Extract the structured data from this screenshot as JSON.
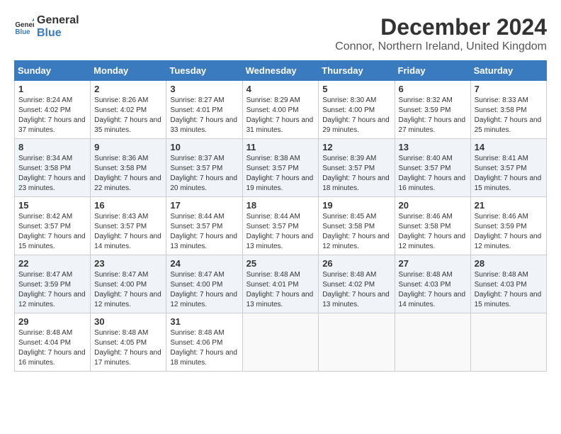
{
  "logo": {
    "line1": "General",
    "line2": "Blue"
  },
  "title": "December 2024",
  "subtitle": "Connor, Northern Ireland, United Kingdom",
  "weekdays": [
    "Sunday",
    "Monday",
    "Tuesday",
    "Wednesday",
    "Thursday",
    "Friday",
    "Saturday"
  ],
  "weeks": [
    [
      {
        "day": "1",
        "sunrise": "8:24 AM",
        "sunset": "4:02 PM",
        "daylight": "7 hours and 37 minutes."
      },
      {
        "day": "2",
        "sunrise": "8:26 AM",
        "sunset": "4:02 PM",
        "daylight": "7 hours and 35 minutes."
      },
      {
        "day": "3",
        "sunrise": "8:27 AM",
        "sunset": "4:01 PM",
        "daylight": "7 hours and 33 minutes."
      },
      {
        "day": "4",
        "sunrise": "8:29 AM",
        "sunset": "4:00 PM",
        "daylight": "7 hours and 31 minutes."
      },
      {
        "day": "5",
        "sunrise": "8:30 AM",
        "sunset": "4:00 PM",
        "daylight": "7 hours and 29 minutes."
      },
      {
        "day": "6",
        "sunrise": "8:32 AM",
        "sunset": "3:59 PM",
        "daylight": "7 hours and 27 minutes."
      },
      {
        "day": "7",
        "sunrise": "8:33 AM",
        "sunset": "3:58 PM",
        "daylight": "7 hours and 25 minutes."
      }
    ],
    [
      {
        "day": "8",
        "sunrise": "8:34 AM",
        "sunset": "3:58 PM",
        "daylight": "7 hours and 23 minutes."
      },
      {
        "day": "9",
        "sunrise": "8:36 AM",
        "sunset": "3:58 PM",
        "daylight": "7 hours and 22 minutes."
      },
      {
        "day": "10",
        "sunrise": "8:37 AM",
        "sunset": "3:57 PM",
        "daylight": "7 hours and 20 minutes."
      },
      {
        "day": "11",
        "sunrise": "8:38 AM",
        "sunset": "3:57 PM",
        "daylight": "7 hours and 19 minutes."
      },
      {
        "day": "12",
        "sunrise": "8:39 AM",
        "sunset": "3:57 PM",
        "daylight": "7 hours and 18 minutes."
      },
      {
        "day": "13",
        "sunrise": "8:40 AM",
        "sunset": "3:57 PM",
        "daylight": "7 hours and 16 minutes."
      },
      {
        "day": "14",
        "sunrise": "8:41 AM",
        "sunset": "3:57 PM",
        "daylight": "7 hours and 15 minutes."
      }
    ],
    [
      {
        "day": "15",
        "sunrise": "8:42 AM",
        "sunset": "3:57 PM",
        "daylight": "7 hours and 15 minutes."
      },
      {
        "day": "16",
        "sunrise": "8:43 AM",
        "sunset": "3:57 PM",
        "daylight": "7 hours and 14 minutes."
      },
      {
        "day": "17",
        "sunrise": "8:44 AM",
        "sunset": "3:57 PM",
        "daylight": "7 hours and 13 minutes."
      },
      {
        "day": "18",
        "sunrise": "8:44 AM",
        "sunset": "3:57 PM",
        "daylight": "7 hours and 13 minutes."
      },
      {
        "day": "19",
        "sunrise": "8:45 AM",
        "sunset": "3:58 PM",
        "daylight": "7 hours and 12 minutes."
      },
      {
        "day": "20",
        "sunrise": "8:46 AM",
        "sunset": "3:58 PM",
        "daylight": "7 hours and 12 minutes."
      },
      {
        "day": "21",
        "sunrise": "8:46 AM",
        "sunset": "3:59 PM",
        "daylight": "7 hours and 12 minutes."
      }
    ],
    [
      {
        "day": "22",
        "sunrise": "8:47 AM",
        "sunset": "3:59 PM",
        "daylight": "7 hours and 12 minutes."
      },
      {
        "day": "23",
        "sunrise": "8:47 AM",
        "sunset": "4:00 PM",
        "daylight": "7 hours and 12 minutes."
      },
      {
        "day": "24",
        "sunrise": "8:47 AM",
        "sunset": "4:00 PM",
        "daylight": "7 hours and 12 minutes."
      },
      {
        "day": "25",
        "sunrise": "8:48 AM",
        "sunset": "4:01 PM",
        "daylight": "7 hours and 13 minutes."
      },
      {
        "day": "26",
        "sunrise": "8:48 AM",
        "sunset": "4:02 PM",
        "daylight": "7 hours and 13 minutes."
      },
      {
        "day": "27",
        "sunrise": "8:48 AM",
        "sunset": "4:03 PM",
        "daylight": "7 hours and 14 minutes."
      },
      {
        "day": "28",
        "sunrise": "8:48 AM",
        "sunset": "4:03 PM",
        "daylight": "7 hours and 15 minutes."
      }
    ],
    [
      {
        "day": "29",
        "sunrise": "8:48 AM",
        "sunset": "4:04 PM",
        "daylight": "7 hours and 16 minutes."
      },
      {
        "day": "30",
        "sunrise": "8:48 AM",
        "sunset": "4:05 PM",
        "daylight": "7 hours and 17 minutes."
      },
      {
        "day": "31",
        "sunrise": "8:48 AM",
        "sunset": "4:06 PM",
        "daylight": "7 hours and 18 minutes."
      },
      null,
      null,
      null,
      null
    ]
  ],
  "labels": {
    "sunrise": "Sunrise:",
    "sunset": "Sunset:",
    "daylight": "Daylight:"
  }
}
